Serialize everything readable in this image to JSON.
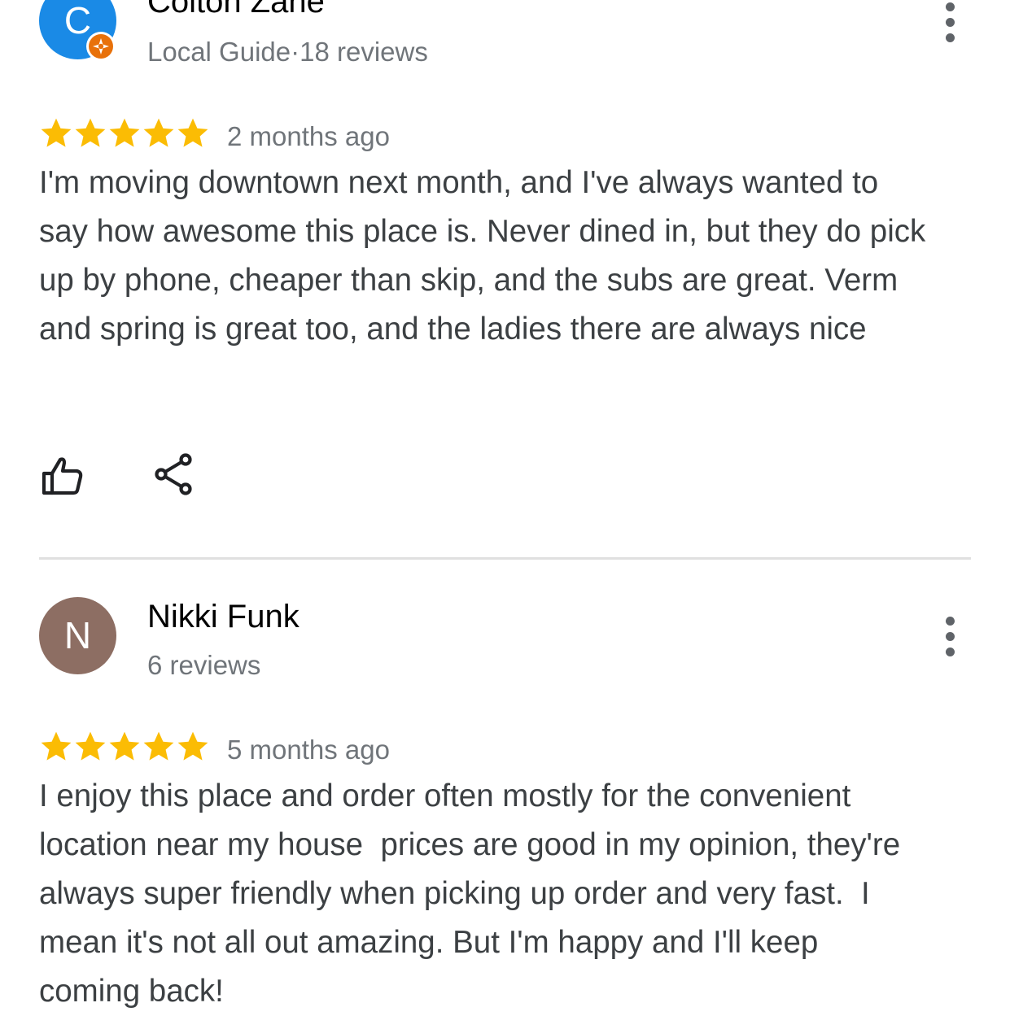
{
  "colors": {
    "star": "#fbbc04",
    "avatar_1": "#1a8ae6",
    "avatar_2": "#8d6e63",
    "guide_badge": "#e8710a",
    "meta_text": "#70757a"
  },
  "reviews": [
    {
      "avatar_letter": "C",
      "name": "Colton Zane",
      "meta": "Local Guide·18 reviews",
      "rating": 5,
      "rating_max": 5,
      "date": "2 months ago",
      "text": "I'm moving downtown next month, and I've always wanted to say how awesome this place is. Never dined in, but they do pick up by phone, cheaper than skip, and the subs are great. Verm and spring is great too, and the ladies there are always nice",
      "icons": [
        "more-vert-icon",
        "local-guide-badge-icon",
        "thumbs-up-icon",
        "share-icon"
      ]
    },
    {
      "avatar_letter": "N",
      "name": "Nikki Funk",
      "meta": "6 reviews",
      "rating": 5,
      "rating_max": 5,
      "date": "5 months ago",
      "text": "I enjoy this place and order often mostly for the convenient location near my house  prices are good in my opinion, they're always super friendly when picking up order and very fast.  I mean it's not all out amazing. But I'm happy and I'll keep coming back!",
      "icons": [
        "more-vert-icon"
      ]
    }
  ]
}
